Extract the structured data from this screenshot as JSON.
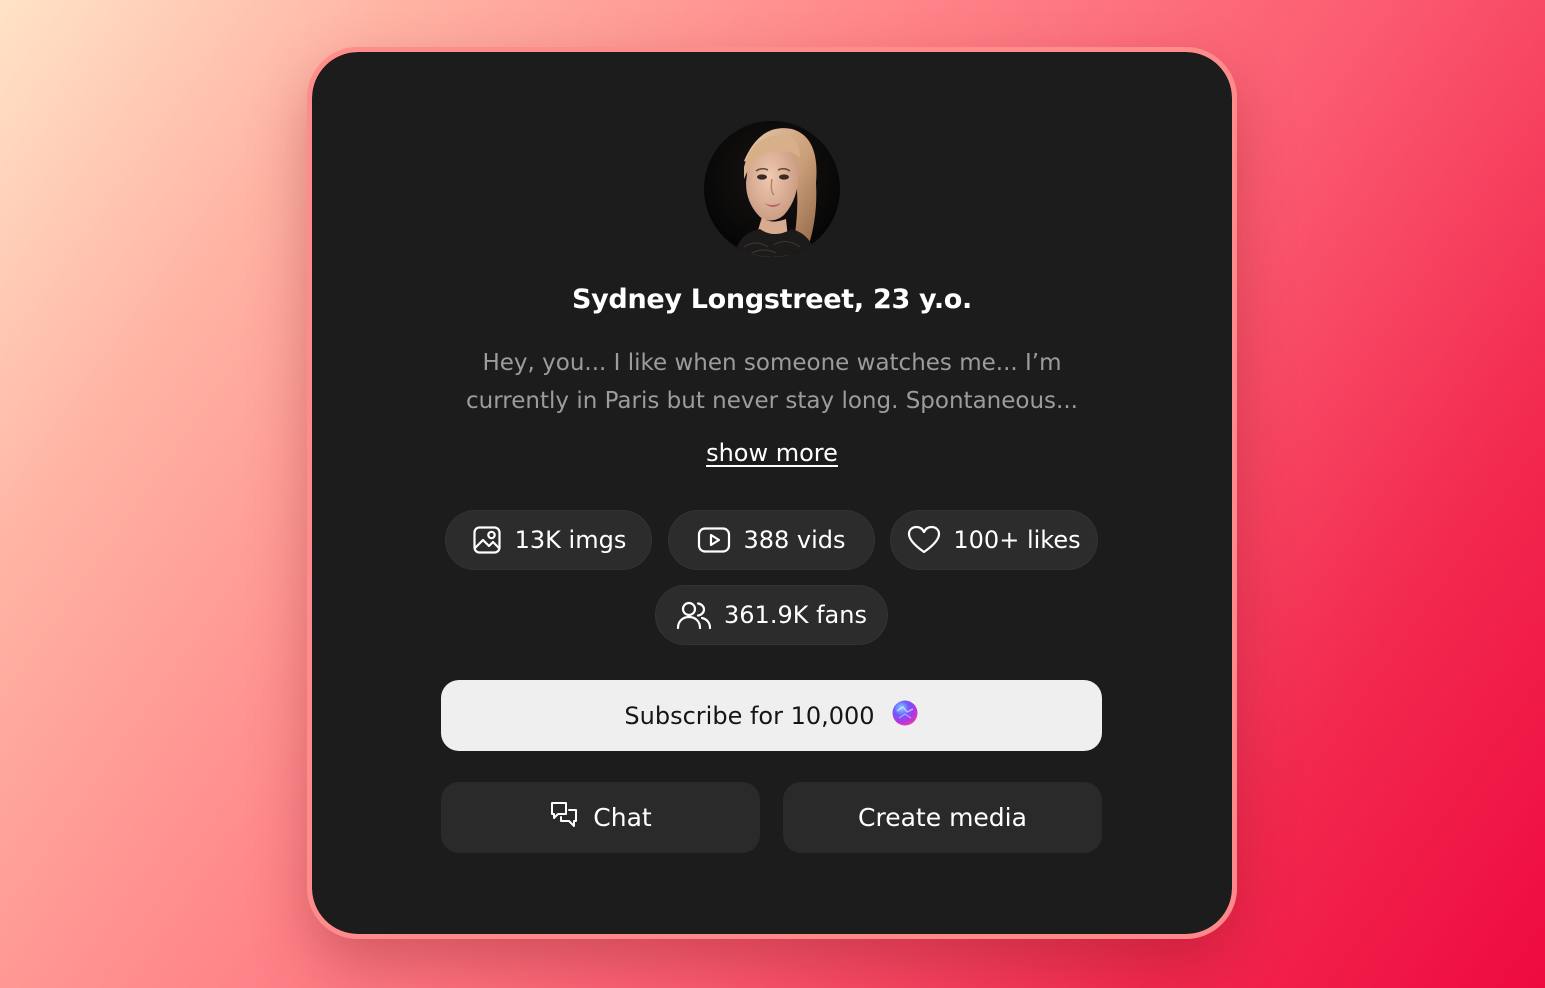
{
  "profile": {
    "name": "Sydney Longstreet, 23 y.o.",
    "bio": "Hey, you... I like when someone watches me... I’m currently in Paris but never stay long. Spontaneous...",
    "show_more": "show more"
  },
  "stats": {
    "images": {
      "label": "13K imgs",
      "icon": "image-icon"
    },
    "videos": {
      "label": "388 vids",
      "icon": "play-icon"
    },
    "likes": {
      "label": "100+ likes",
      "icon": "heart-icon"
    },
    "fans": {
      "label": "361.9K fans",
      "icon": "users-icon"
    }
  },
  "actions": {
    "subscribe_label": "Subscribe for 10,000",
    "subscribe_icon": "gem-icon",
    "chat_label": "Chat",
    "chat_icon": "chat-icon",
    "create_label": "Create media"
  },
  "colors": {
    "card_background": "#1c1c1c",
    "pill_background": "#2c2c2c",
    "primary_button": "#efefef",
    "text_primary": "#ffffff",
    "text_muted": "#9c9c9c",
    "card_border": "#ff8c8c"
  }
}
